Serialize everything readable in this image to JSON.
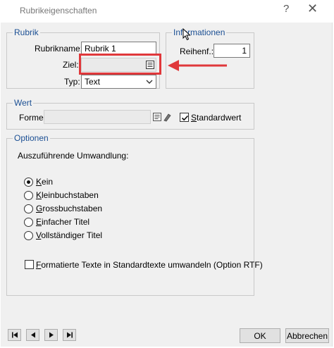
{
  "window": {
    "title": "Rubrikeigenschaften",
    "help_symbol": "?",
    "close_symbol": "✕"
  },
  "rubrik": {
    "legend": "Rubrik",
    "name_label": "Rubrikname:",
    "name_value": "Rubrik 1",
    "ziel_label": "Ziel:",
    "ziel_value": "",
    "typ_label": "Typ:",
    "typ_value": "Text"
  },
  "informationen": {
    "legend": "Informationen",
    "reihenfolge_label": "Reihenf.:",
    "reihenfolge_value": "1"
  },
  "wert": {
    "legend": "Wert",
    "formel_label": "Formel:",
    "formel_value": "",
    "standardwert_label": "Standardwert",
    "standardwert_checked": true
  },
  "optionen": {
    "legend": "Optionen",
    "heading": "Auszuführende Umwandlung:",
    "radios": [
      {
        "first": "K",
        "rest": "ein",
        "selected": true
      },
      {
        "first": "K",
        "rest": "leinbuchstaben",
        "selected": false
      },
      {
        "first": "G",
        "rest": "rossbuchstaben",
        "selected": false
      },
      {
        "first": "E",
        "rest": "infacher Titel",
        "selected": false
      },
      {
        "first": "V",
        "rest": "ollständiger Titel",
        "selected": false
      }
    ],
    "rtf_first": "F",
    "rtf_rest": "ormatierte Texte in Standardtexte umwandeln (Option RTF)",
    "rtf_checked": false
  },
  "footer": {
    "ok_label": "OK",
    "cancel_label": "Abbrechen"
  },
  "colors": {
    "group_title": "#1b4f93",
    "highlight": "#e0383b",
    "window_bg": "#f0f0f0"
  },
  "icons": [
    "list-picker-icon",
    "formula-editor-icon",
    "chevron-down-icon",
    "first-record-icon",
    "previous-record-icon",
    "next-record-icon",
    "last-record-icon"
  ]
}
